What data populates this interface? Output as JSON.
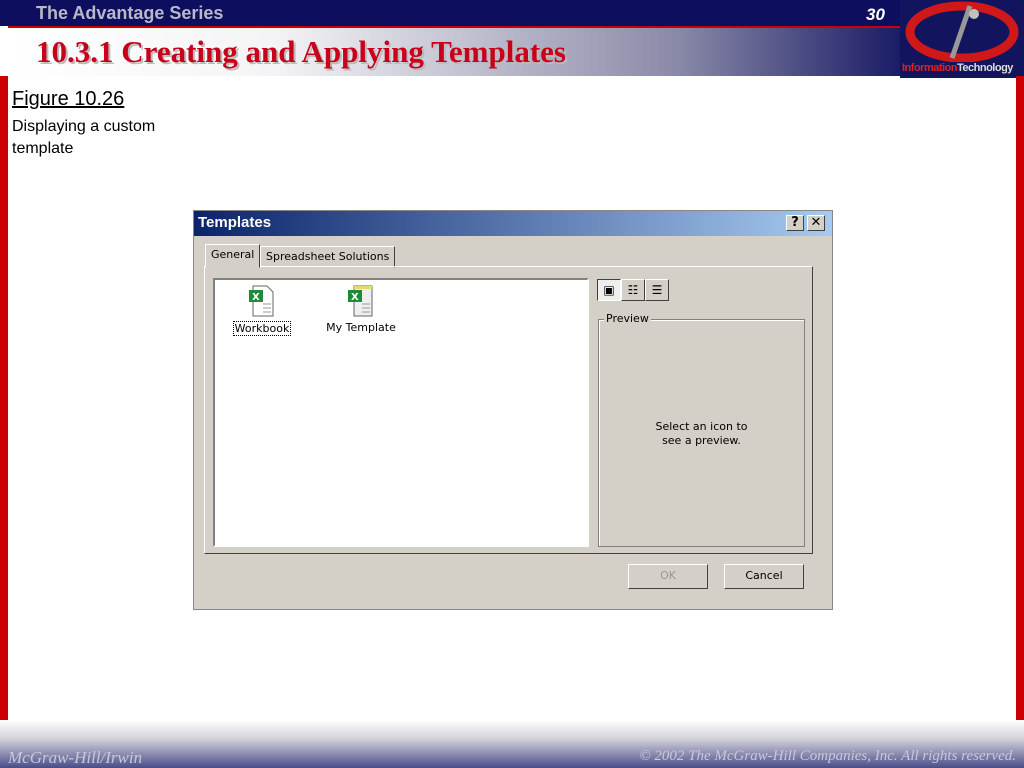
{
  "slide": {
    "series": "The Advantage Series",
    "page_number": "30",
    "title": "10.3.1 Creating and Applying Templates",
    "logo_text_a": "Information",
    "logo_text_b": "Technology",
    "figure": "Figure 10.26",
    "caption": "Displaying a custom template",
    "footer_left": "McGraw-Hill/Irwin",
    "footer_right": "© 2002  The McGraw-Hill Companies, Inc. All rights reserved."
  },
  "dialog": {
    "title": "Templates",
    "help": "?",
    "close": "✕",
    "tabs": [
      {
        "label": "General",
        "active": true
      },
      {
        "label": "Spreadsheet Solutions",
        "active": false
      }
    ],
    "items": [
      {
        "label": "Workbook",
        "icon": "excel-workbook-icon",
        "selected": true
      },
      {
        "label": "My Template",
        "icon": "excel-template-icon",
        "selected": false
      }
    ],
    "views": [
      "large-icons",
      "list",
      "details"
    ],
    "preview_label": "Preview",
    "preview_message": "Select an icon to see a preview.",
    "ok": "OK",
    "cancel": "Cancel"
  }
}
